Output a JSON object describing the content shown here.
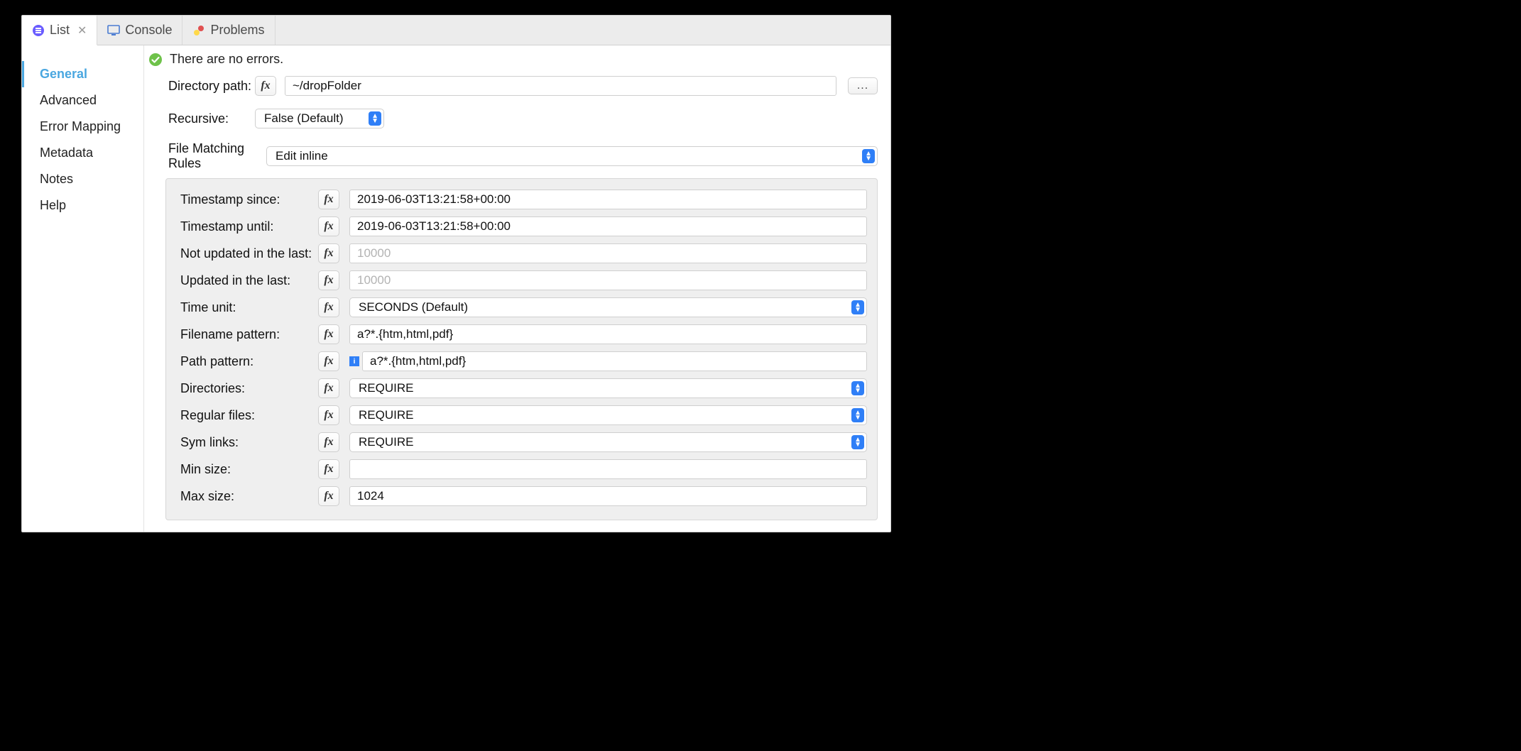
{
  "tabs": {
    "list": {
      "label": "List"
    },
    "console": {
      "label": "Console"
    },
    "problems": {
      "label": "Problems"
    }
  },
  "sidebar": {
    "items": [
      {
        "label": "General"
      },
      {
        "label": "Advanced"
      },
      {
        "label": "Error Mapping"
      },
      {
        "label": "Metadata"
      },
      {
        "label": "Notes"
      },
      {
        "label": "Help"
      }
    ]
  },
  "status": {
    "text": "There are no errors."
  },
  "fields": {
    "directory_path": {
      "label": "Directory path:",
      "value": "~/dropFolder"
    },
    "recursive": {
      "label": "Recursive:",
      "value": "False (Default)"
    },
    "file_matching_rules": {
      "label": "File Matching Rules",
      "value": "Edit inline"
    }
  },
  "rules": {
    "timestamp_since": {
      "label": "Timestamp since:",
      "value": "2019-06-03T13:21:58+00:00"
    },
    "timestamp_until": {
      "label": "Timestamp until:",
      "value": "2019-06-03T13:21:58+00:00"
    },
    "not_updated": {
      "label": "Not updated in the last:",
      "placeholder": "10000",
      "value": ""
    },
    "updated": {
      "label": "Updated in the last:",
      "placeholder": "10000",
      "value": ""
    },
    "time_unit": {
      "label": "Time unit:",
      "value": "SECONDS (Default)"
    },
    "filename_pattern": {
      "label": "Filename pattern:",
      "value": "a?*.{htm,html,pdf}"
    },
    "path_pattern": {
      "label": "Path pattern:",
      "value": "a?*.{htm,html,pdf}"
    },
    "directories": {
      "label": "Directories:",
      "value": "REQUIRE"
    },
    "regular_files": {
      "label": "Regular files:",
      "value": "REQUIRE"
    },
    "sym_links": {
      "label": "Sym links:",
      "value": "REQUIRE"
    },
    "min_size": {
      "label": "Min size:",
      "value": ""
    },
    "max_size": {
      "label": "Max size:",
      "value": "1024"
    }
  },
  "fx": "fx",
  "dots": "..."
}
